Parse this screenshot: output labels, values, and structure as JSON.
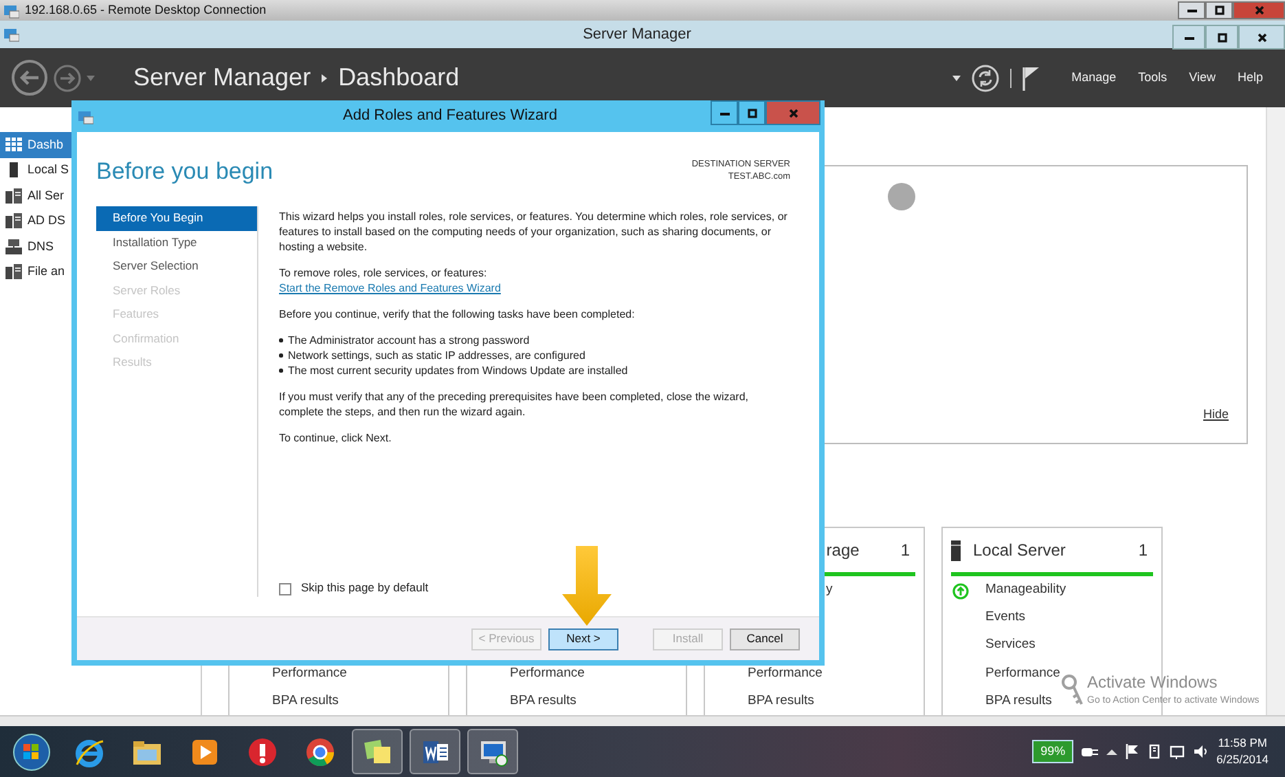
{
  "rdp_window": {
    "title": "192.168.0.65 - Remote Desktop Connection"
  },
  "app_window": {
    "title": "Server Manager"
  },
  "header": {
    "breadcrumb": [
      "Server Manager",
      "Dashboard"
    ],
    "menu": [
      "Manage",
      "Tools",
      "View",
      "Help"
    ]
  },
  "nav": [
    {
      "label": "Dashb",
      "selected": true
    },
    {
      "label": "Local S",
      "selected": false
    },
    {
      "label": "All Ser",
      "selected": false
    },
    {
      "label": "AD DS",
      "selected": false
    },
    {
      "label": "DNS",
      "selected": false
    },
    {
      "label": "File an",
      "selected": false
    }
  ],
  "welcome_panel": {
    "hide_link": "Hide"
  },
  "tiles": [
    {
      "rows": [
        {
          "text": "Performance"
        },
        {
          "text": "BPA results"
        }
      ]
    },
    {
      "rows": [
        {
          "text": "Performance"
        },
        {
          "text": "BPA results"
        }
      ]
    },
    {
      "title": "rage",
      "count": "1",
      "rows": [
        {
          "text": "y"
        },
        {
          "text": "Performance"
        },
        {
          "text": "BPA results"
        }
      ]
    },
    {
      "title": "Local Server",
      "count": "1",
      "rows": [
        {
          "text": "Manageability",
          "ok": true
        },
        {
          "text": "Events",
          "ok": false
        },
        {
          "text": "Services",
          "ok": false
        },
        {
          "text": "Performance",
          "ok": false
        },
        {
          "text": "BPA results",
          "ok": false
        }
      ]
    }
  ],
  "wizard": {
    "title": "Add Roles and Features Wizard",
    "heading": "Before you begin",
    "destination_label": "DESTINATION SERVER",
    "destination_server": "TEST.ABC.com",
    "steps": [
      {
        "label": "Before You Begin",
        "selected": true,
        "disabled": false
      },
      {
        "label": "Installation Type",
        "selected": false,
        "disabled": false
      },
      {
        "label": "Server Selection",
        "selected": false,
        "disabled": false
      },
      {
        "label": "Server Roles",
        "selected": false,
        "disabled": true
      },
      {
        "label": "Features",
        "selected": false,
        "disabled": true
      },
      {
        "label": "Confirmation",
        "selected": false,
        "disabled": true
      },
      {
        "label": "Results",
        "selected": false,
        "disabled": true
      }
    ],
    "blocks": [
      {
        "kind": "text",
        "text": "This wizard helps you install roles, role services, or features. You determine which roles, role services, or features to install based on the computing needs of your organization, such as sharing documents, or hosting a website."
      },
      {
        "kind": "text",
        "text": "To remove roles, role services, or features:",
        "link": "Start the Remove Roles and Features Wizard"
      },
      {
        "kind": "text",
        "text": "Before you continue, verify that the following tasks have been completed:"
      },
      {
        "kind": "bullets",
        "items": [
          "The Administrator account has a strong password",
          "Network settings, such as static IP addresses, are configured",
          "The most current security updates from Windows Update are installed"
        ]
      },
      {
        "kind": "text",
        "text": "If you must verify that any of the preceding prerequisites have been completed, close the wizard, complete the steps, and then run the wizard again."
      },
      {
        "kind": "text",
        "text": "To continue, click Next."
      }
    ],
    "skip_checkbox": {
      "label": "Skip this page by default",
      "checked": false
    },
    "buttons": [
      {
        "label": "< Previous",
        "disabled": true,
        "default": false
      },
      {
        "label": "Next >",
        "disabled": false,
        "default": true
      },
      {
        "label": "Install",
        "disabled": true,
        "default": false
      },
      {
        "label": "Cancel",
        "disabled": false,
        "default": false
      }
    ]
  },
  "activation_notice": {
    "title": "Activate Windows",
    "text": "Go to Action Center to activate Windows"
  },
  "taskbar": {
    "apps": [
      {
        "kind": "ie",
        "active": false
      },
      {
        "kind": "folder",
        "active": false
      },
      {
        "kind": "media",
        "active": false
      },
      {
        "kind": "red",
        "active": false
      },
      {
        "kind": "chrome",
        "active": false
      },
      {
        "kind": "notes",
        "active": true
      },
      {
        "kind": "word",
        "active": true
      },
      {
        "kind": "rdp",
        "active": true
      }
    ],
    "battery": "99%",
    "time": "11:58 PM",
    "date": "6/25/2014"
  }
}
